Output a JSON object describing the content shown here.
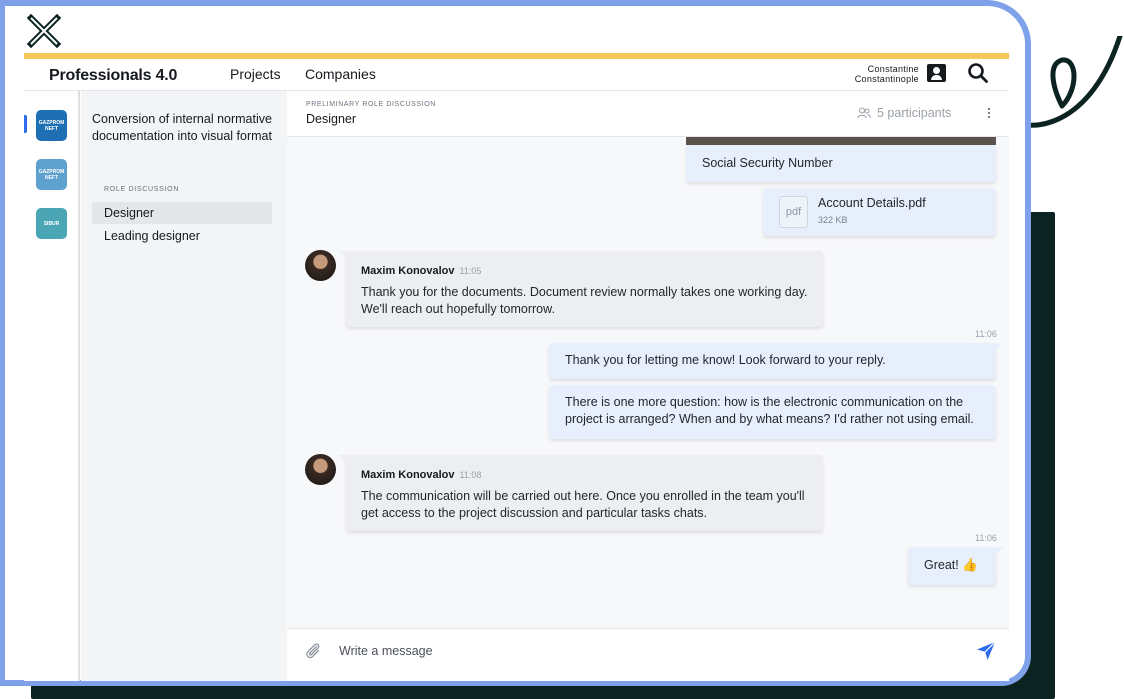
{
  "app": {
    "title": "Professionals 4.0"
  },
  "nav": {
    "projects": "Projects",
    "companies": "Companies"
  },
  "user": {
    "first_name": "Constantine",
    "last_name": "Constantinople"
  },
  "companies": [
    {
      "line1": "GAZPROM",
      "line2": "NEFT",
      "active": true
    },
    {
      "line1": "GAZPROM",
      "line2": "NEFT",
      "active": false
    },
    {
      "line1": "SIBUR",
      "line2": "",
      "active": false
    }
  ],
  "threads": {
    "project_title": "Conversion of internal normative documentation into visual format",
    "section_label": "ROLE DISCUSSION",
    "items": [
      {
        "label": "Designer",
        "active": true
      },
      {
        "label": "Leading designer",
        "active": false
      }
    ]
  },
  "chat": {
    "overline": "PRELIMINARY ROLE DISCUSSION",
    "title": "Designer",
    "participants": "5 participants",
    "messages": [
      {
        "text": "Social Security Number"
      },
      {
        "file_type": "pdf",
        "file_name": "Account Details.pdf",
        "file_size": "322 KB"
      },
      {
        "sender": "Maxim Konovalov",
        "time": "11:05",
        "text": "Thank you for the documents. Document review normally takes one working day. We'll reach out hopefully tomorrow."
      },
      {
        "time": "11:06",
        "text": "Thank you for letting me know! Look forward to your reply."
      },
      {
        "text": "There is one more question: how is the electronic communication on the project is arranged? When and by what means? I'd rather not using email."
      },
      {
        "sender": "Maxim Konovalov",
        "time": "11:08",
        "text": "The communication will be carried out here. Once you enrolled in the team you'll get access to the project discussion and particular tasks chats."
      },
      {
        "time": "11:06",
        "text": "Great! 👍"
      }
    ],
    "composer": {
      "placeholder": "Write a message"
    }
  },
  "colors": {
    "accent": "#2d6bef",
    "frame": "#7ea1ea",
    "stripe": "#f5c65a",
    "dark": "#0c2421"
  }
}
